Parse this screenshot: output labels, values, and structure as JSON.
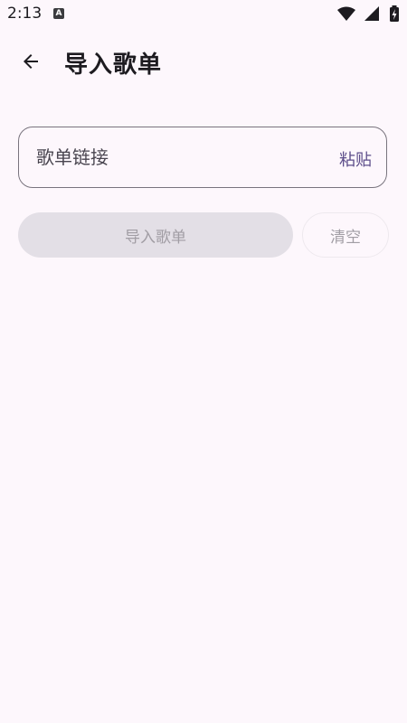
{
  "status_bar": {
    "time": "2:13",
    "notification_icon": "A"
  },
  "app_bar": {
    "title": "导入歌单",
    "back_icon": "arrow-back-icon"
  },
  "link_field": {
    "placeholder": "歌单链接",
    "value": "",
    "paste_label": "粘贴"
  },
  "actions": {
    "import_label": "导入歌单",
    "clear_label": "清空"
  },
  "colors": {
    "background": "#FDF7FC",
    "accent": "#5C4D8A",
    "disabled_text": "#A19DA4",
    "disabled_bg": "#E3DFE6"
  }
}
